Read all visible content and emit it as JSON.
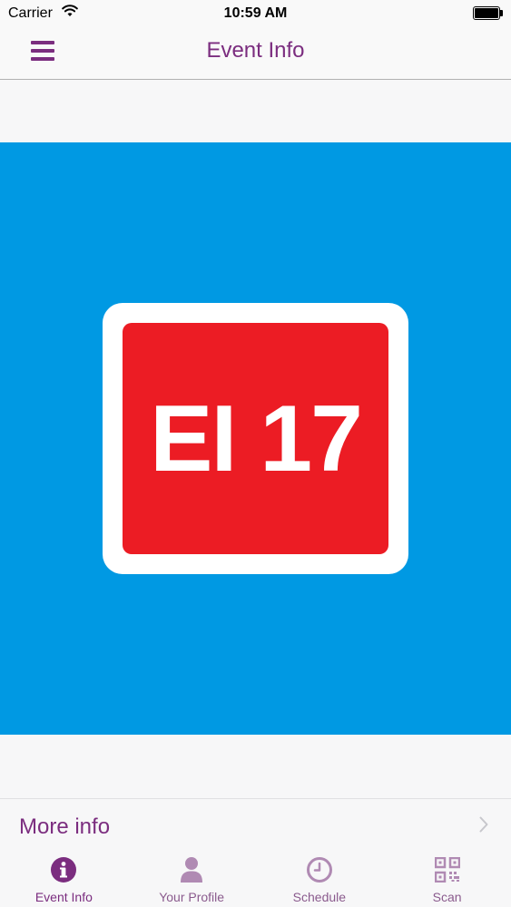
{
  "status_bar": {
    "carrier": "Carrier",
    "time": "10:59 AM"
  },
  "nav": {
    "title": "Event Info",
    "menu_icon": "hamburger-menu-icon"
  },
  "banner": {
    "background_color": "#0099e3",
    "logo_text": "EI 17",
    "logo_color": "#ec1c24"
  },
  "more_info": {
    "label": "More info",
    "icon": "chevron-right-icon"
  },
  "tabs": [
    {
      "label": "Event Info",
      "icon": "info-icon",
      "active": true
    },
    {
      "label": "Your Profile",
      "icon": "person-icon",
      "active": false
    },
    {
      "label": "Schedule",
      "icon": "clock-icon",
      "active": false
    },
    {
      "label": "Scan",
      "icon": "qr-code-icon",
      "active": false
    }
  ],
  "colors": {
    "accent": "#7b2d7f",
    "inactive_icon": "#b08ab3"
  }
}
